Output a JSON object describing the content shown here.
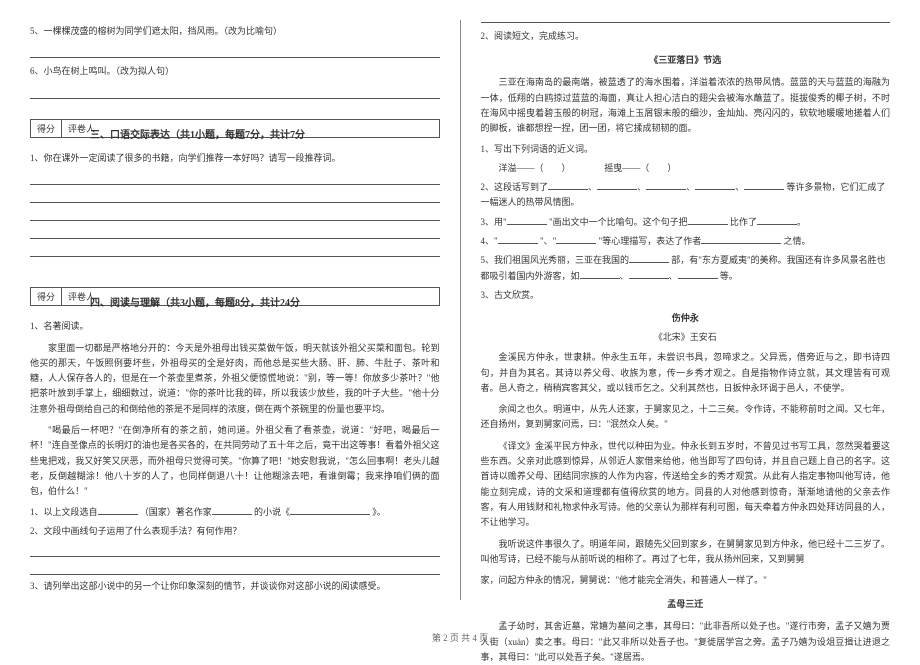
{
  "left": {
    "q5": "5、一棵棵茂盛的榕树为同学们遮太阳，挡风雨。（改为比喻句）",
    "q6": "6、小鸟在树上鸣叫。（改为拟人句）",
    "score_labels": {
      "score": "得分",
      "grader": "评卷人"
    },
    "section3": {
      "title": "三、口语交际表达（共1小题，每题7分，共计7分",
      "q1": "1、你在课外一定阅读了很多的书籍，向学们推荐一本好吗？请写一段推荐词。"
    },
    "section4": {
      "title": "四、阅读与理解（共3小题，每题8分，共计24分",
      "q1_label": "1、名著阅读。",
      "p1": "家里面一切都是严格地分开的：今天是外祖母出钱买菜做午饭，明天就该外祖父买菜和面包。轮到他买的那天，午饭照例要坏些，外祖母买的全是好肉，而他总是买些大肠、肝、肺、牛肚子、茶叶和糖，人人保存各人的，但是在一个茶壶里煮茶，外祖父便惊慌地说：\"别，等一等！你放多少茶叶？\"他把茶叶放到手掌上，细细数过，说道：\"你的茶叶比我的碎，所以我该少放些，我的叶子大些。\"他十分注意外祖母倒给自己的和倒给他的茶是不是同样的浓度，倒在两个茶碗里的份量也要平均。",
      "p2": "\"喝最后一杯吧？\"在倒净所有的茶之前，她问道。外祖父看了看茶壶，说道：\"好吧，喝最后一杯！\"连自圣像点的长明灯的油也是各买各的，在共同劳动了五十年之后，竟干出这等事！看着外祖父这些鬼把戏，我又好笑又厌恶，而外祖母只觉得可笑。\"你算了吧！\"她安慰我说，\"怎么回事啊！老头儿越老，反倒越糊涂！他八十岁的人了，也同样倒退八十！让他糊涂去吧，看谁倒霉；我来挣咱们俩的面包，伯什么！\"",
      "sq1_a": "1、以上文段选自",
      "sq1_b": "（国家）著名作家",
      "sq1_c": "的小说《",
      "sq1_d": "》。",
      "sq2": "2、文段中画线句子运用了什么表现手法？有何作用？",
      "sq3": "3、请列举出这部小说中的另一个让你印象深刻的情节，并谈谈你对这部小说的阅读感受。"
    }
  },
  "right": {
    "q2_label": "2、阅读短文，完成练习。",
    "passage1": {
      "title": "《三亚落日》节选",
      "p1": "三亚在海南岛的最南端，被蓝透了的海水围着，洋溢着浓浓的热带风情。蓝蓝的天与蓝蓝的海融为一体，低翔的白鸥掠过蓝蓝的海面，真让人担心洁白的翅尖会被海水蘸蓝了。挺拔俊秀的椰子树，不时在海风中摇曳着碧玉般的树冠，海滩上玉屑银末般的细沙，金灿灿、亮闪闪的，软软地暖暖地搓着人们的脚板，谁都想捏一捏，团一团，将它揉成韧韧的面。",
      "sq1": "1、写出下列词语的近义词。",
      "sq1_a": "洋溢——（",
      "sq1_b": "摇曳——（",
      "sq2": "2、这段话写到了",
      "sq2_b": "等许多景物，它们汇成了一幅迷人的热带风情图。",
      "sq3": "3、用\"",
      "sq3_a": "\"画出文中一个比喻句。这个句子把",
      "sq3_b": "比作了",
      "sq4": "4、\"",
      "sq4_a": "\"、\"",
      "sq4_b": "\"等心理描写，表达了作者",
      "sq4_c": "之情。",
      "sq5": "5、我们祖国风光秀丽，三亚在我国的",
      "sq5_a": "部，有\"东方夏威夷\"的美称。我国还有许多风景名胜也都吸引着国内外游客，如",
      "sq5_b": "等。",
      "sq6": "3、古文欣赏。"
    },
    "passage2": {
      "title": "伤仲永",
      "author": "《北宋》王安石",
      "p1": "金溪民方仲永，世隶耕。仲永生五年，未尝识书具，忽啼求之。父异焉，借旁近与之，即书诗四句，并自为其名。其诗以养父母、收族为意，传一乡秀才观之。自是指物作诗立就，其文理皆有可观者。邑人奇之，稍稍宾客其父，或以钱币乞之。父利其然也，日扳仲永环谒于邑人，不使学。",
      "p2": "余闻之也久。明道中，从先人还家，于舅家见之，十二三矣。令作诗，不能称前时之闻。又七年，还自扬州，复到舅家问焉，曰：\"泯然众人矣。\"",
      "p3": "《译文》金溪平民方仲永，世代以种田为业。仲永长到五岁时，不曾见过书写工具，忽然哭着要这些东西。父亲对此感到惊异，从邻近人家借来给他，他当即写了四句诗，并且自己题上自己的名字。这首诗以赡养父母、团结同宗族的人作为内容，传送给全乡的秀才观赏。从此有人指定事物叫他写诗，他能立刻完成，诗的文采和道理都有值得欣赏的地方。同县的人对他感到惊奇，渐渐地请他的父亲去作客，有人用钱财和礼物求仲永写诗。他的父亲认为那样有利可图，每天牵着方仲永四处拜访同县的人，不让他学习。",
      "p4": "我听说这件事很久了。明道年间，跟随先父回到家乡，在舅舅家见到方仲永，他已经十二三岁了。叫他写诗，已经不能与从前听说的相称了。再过了七年，我从扬州回来，又到舅舅",
      "p5": "家，问起方仲永的情况，舅舅说：\"他才能完全消失，和普通人一样了。\""
    },
    "passage3": {
      "title": "孟母三迁",
      "p1": "孟子幼时，其舍近墓，常嬉为墓间之事，其母曰：\"此非吾所以处子也。\"遂行市旁，孟子又嬉为贾人街（xuàn）卖之事。母曰：\"此又非所以处吾子也。\"复徙居学宫之旁。孟子乃嬉为设俎豆揖让进退之事，其母曰：\"此可以处吾子矣。\"遂居焉。"
    }
  },
  "footer": "第 2 页 共 4 页"
}
